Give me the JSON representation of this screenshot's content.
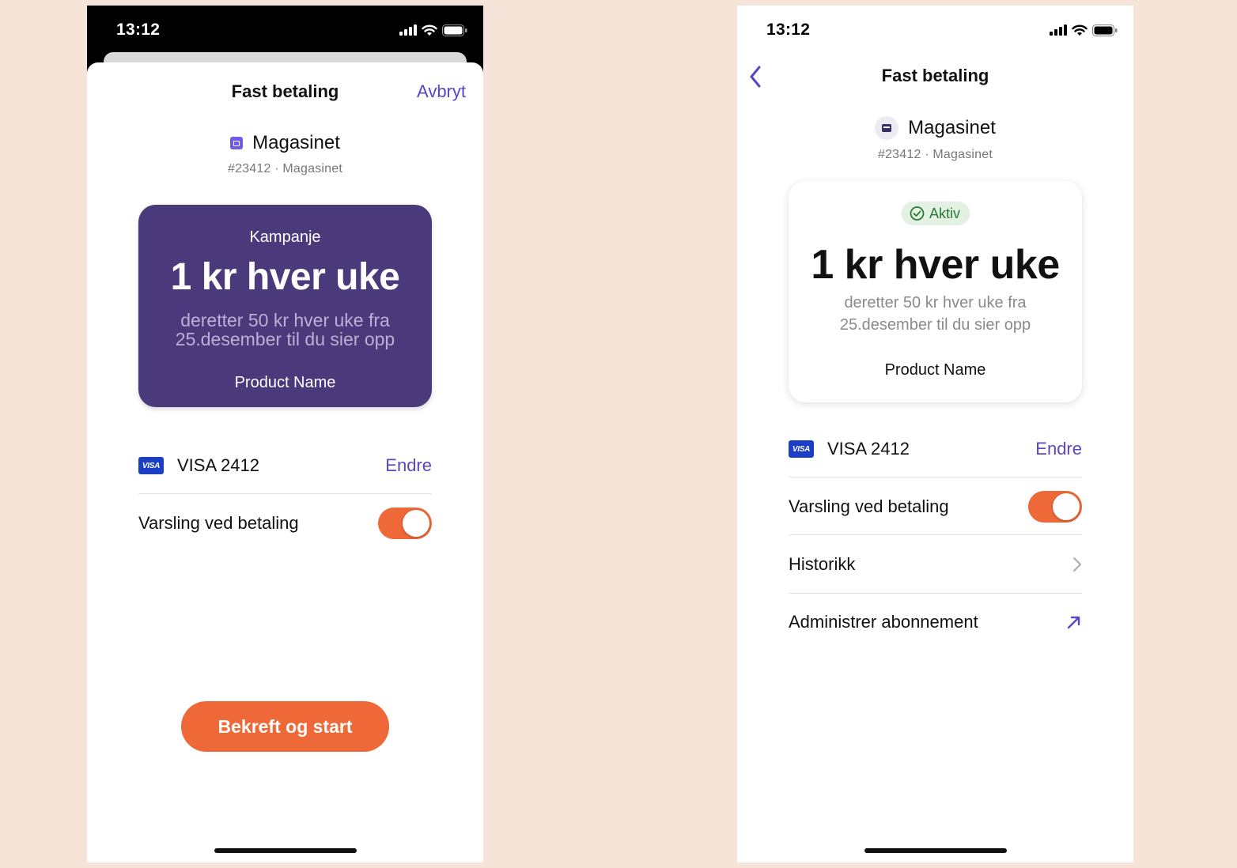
{
  "left": {
    "status_time": "13:12",
    "nav_title": "Fast betaling",
    "cancel_label": "Avbryt",
    "merchant_name": "Magasinet",
    "merchant_sub": "#23412 · Magasinet",
    "card_tag": "Kampanje",
    "card_price": "1 kr hver uke",
    "card_desc": "deretter 50 kr hver uke fra 25.desember til du sier opp",
    "card_product": "Product Name",
    "payment_method": "VISA 2412",
    "change_label": "Endre",
    "notify_label": "Varsling ved betaling",
    "notify_on": true,
    "cta_label": "Bekreft og start"
  },
  "right": {
    "status_time": "13:12",
    "nav_title": "Fast betaling",
    "merchant_name": "Magasinet",
    "merchant_sub": "#23412 · Magasinet",
    "status_badge": "Aktiv",
    "card_price": "1 kr hver uke",
    "card_desc": "deretter 50 kr hver uke fra 25.desember til du sier opp",
    "card_product": "Product Name",
    "payment_method": "VISA 2412",
    "change_label": "Endre",
    "notify_label": "Varsling ved betaling",
    "notify_on": true,
    "history_label": "Historikk",
    "manage_label": "Administrer abonnement"
  },
  "visa_text": "VISA",
  "colors": {
    "accent": "#5b45c4",
    "orange": "#ee6838",
    "card_purple": "#4a3a7b",
    "background": "#f7e4d8",
    "active_green": "#2a7a35"
  }
}
